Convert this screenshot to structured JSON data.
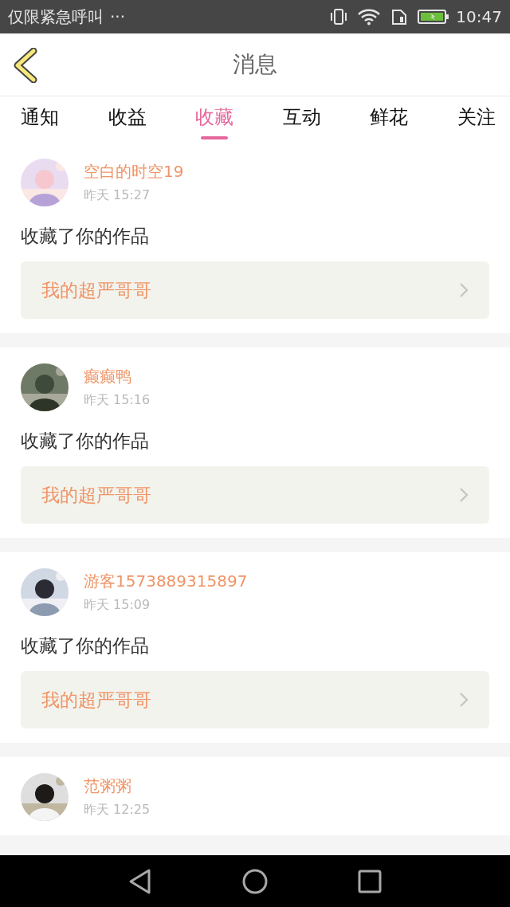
{
  "status_bar": {
    "carrier": "仅限紧急呼叫",
    "more": "···",
    "time": "10:47"
  },
  "header": {
    "title": "消息"
  },
  "tabs": [
    {
      "label": "通知",
      "selected": false
    },
    {
      "label": "收益",
      "selected": false
    },
    {
      "label": "收藏",
      "selected": true
    },
    {
      "label": "互动",
      "selected": false
    },
    {
      "label": "鲜花",
      "selected": false
    },
    {
      "label": "关注",
      "selected": false
    }
  ],
  "messages": [
    {
      "user": "空白的时空19",
      "time": "昨天 15:27",
      "action": "收藏了你的作品",
      "work": "我的超严哥哥"
    },
    {
      "user": "癫癫鸭",
      "time": "昨天 15:16",
      "action": "收藏了你的作品",
      "work": "我的超严哥哥"
    },
    {
      "user": "游客1573889315897",
      "time": "昨天 15:09",
      "action": "收藏了你的作品",
      "work": "我的超严哥哥"
    },
    {
      "user": "范粥粥",
      "time": "昨天 12:25"
    }
  ]
}
